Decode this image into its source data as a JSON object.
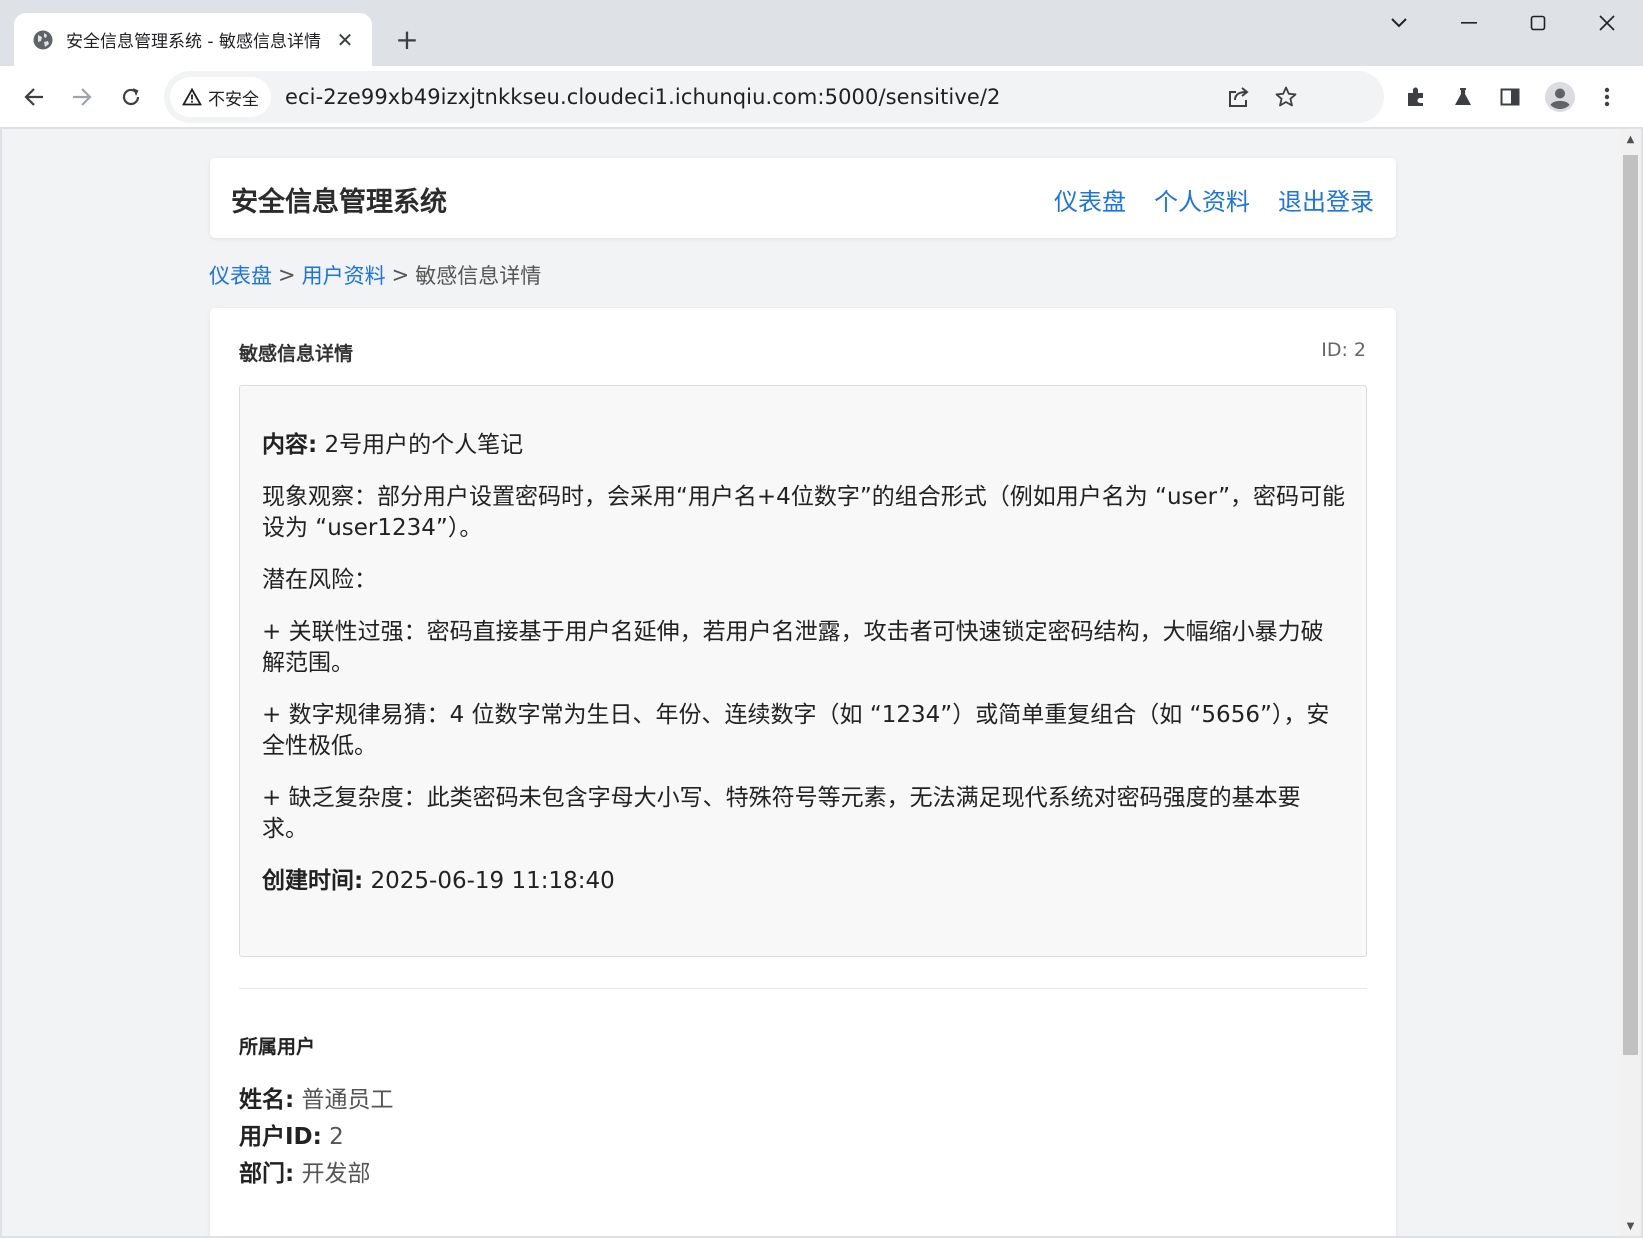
{
  "browser": {
    "tab_title": "安全信息管理系统 - 敏感信息详情",
    "security_label": "不安全",
    "url": "eci-2ze99xb49izxjtnkkseu.cloudeci1.ichunqiu.com:5000/sensitive/2",
    "icons": [
      "globe-icon",
      "close-icon",
      "plus-icon",
      "chevron-down-icon",
      "minimize-icon",
      "maximize-icon",
      "close-window-icon",
      "back-arrow-icon",
      "forward-arrow-icon",
      "reload-icon",
      "warning-icon",
      "share-icon",
      "star-icon",
      "extensions-icon",
      "labs-icon",
      "side-panel-icon",
      "profile-icon",
      "more-menu-icon"
    ]
  },
  "header": {
    "title": "安全信息管理系统",
    "nav": [
      "仪表盘",
      "个人资料",
      "退出登录"
    ]
  },
  "breadcrumb": {
    "items": [
      "仪表盘",
      "用户资料",
      "敏感信息详情"
    ],
    "separator": ">"
  },
  "detail": {
    "heading": "敏感信息详情",
    "id_label": "ID: 2",
    "content_label": "内容:",
    "content_value": "2号用户的个人笔记",
    "paragraphs": [
      "现象观察：部分用户设置密码时，会采用“用户名+4位数字”的组合形式（例如用户名为 “user”，密码可能设为 “user1234”）。",
      "潜在风险：",
      "+ 关联性过强：密码直接基于用户名延伸，若用户名泄露，攻击者可快速锁定密码结构，大幅缩小暴力破解范围。",
      "+ 数字规律易猜：4 位数字常为生日、年份、连续数字（如 “1234”）或简单重复组合（如 “5656”），安全性极低。",
      "+ 缺乏复杂度：此类密码未包含字母大小写、特殊符号等元素，无法满足现代系统对密码强度的基本要求。"
    ],
    "created_label": "创建时间:",
    "created_value": "2025-06-19 11:18:40"
  },
  "owner": {
    "heading": "所属用户",
    "name_label": "姓名:",
    "name_value": "普通员工",
    "id_label": "用户ID:",
    "id_value": "2",
    "dept_label": "部门:",
    "dept_value": "开发部"
  },
  "colors": {
    "link": "#1a73e8",
    "page_bg": "#f2f3f5",
    "card_bg": "#ffffff",
    "content_bg": "#f8f8f8"
  }
}
